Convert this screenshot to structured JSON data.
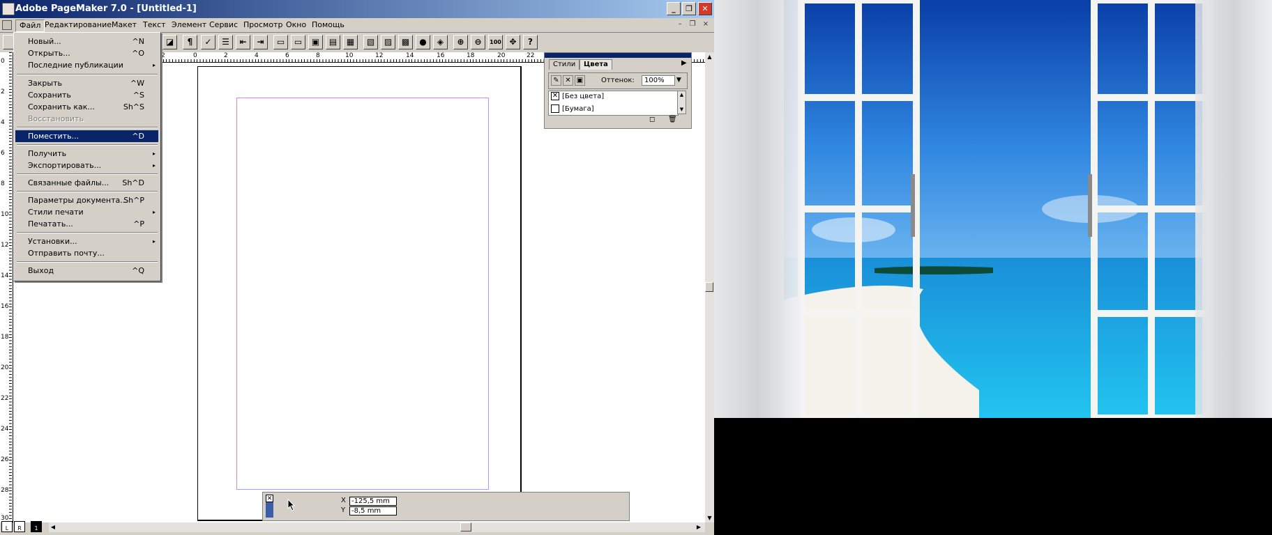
{
  "window": {
    "title": "Adobe PageMaker 7.0 - [Untitled-1]",
    "min_label": "_",
    "max_label": "❐",
    "close_label": "✕"
  },
  "menubar": {
    "items": [
      "Файл",
      "Редактирование",
      "Макет",
      "Текст",
      "Элемент",
      "Сервис",
      "Просмотр",
      "Окно",
      "Помощь"
    ],
    "active": "Файл",
    "mdi_controls": [
      "–",
      "❐",
      "×"
    ]
  },
  "toolbar": {
    "icons": [
      "tool-icon",
      "new-icon",
      "paragraph-icon",
      "spell-icon",
      "bullets-icon",
      "indent-left-icon",
      "indent-right-icon",
      "copy-style-icon",
      "paste-style-icon",
      "frame-icon",
      "image-frame-icon",
      "link-icon",
      "insert-image-icon",
      "export-image-icon",
      "color-icon",
      "globe-icon",
      "pdf-icon",
      "zoom-in-icon",
      "zoom-out-icon",
      "actual-size-icon",
      "fit-icon",
      "help-icon"
    ],
    "glyphs": [
      "◪",
      "¶",
      "✓",
      "☰",
      "⇤",
      "⇥",
      "▭",
      "▭",
      "▣",
      "▤",
      "▦",
      "▧",
      "▨",
      "▩",
      "●",
      "◈",
      "⊕",
      "⊖",
      "100",
      "✥",
      "?"
    ]
  },
  "file_menu": {
    "items": [
      {
        "label": "Новый...",
        "shortcut": "^N"
      },
      {
        "label": "Открыть...",
        "shortcut": "^O"
      },
      {
        "label": "Последние публикации",
        "shortcut": "",
        "submenu": "▸"
      },
      {
        "sep": true
      },
      {
        "label": "Закрыть",
        "shortcut": "^W"
      },
      {
        "label": "Сохранить",
        "shortcut": "^S"
      },
      {
        "label": "Сохранить как...",
        "shortcut": "Sh^S"
      },
      {
        "label": "Восстановить",
        "shortcut": "",
        "disabled": true
      },
      {
        "sep": true
      },
      {
        "label": "Поместить...",
        "shortcut": "^D",
        "highlighted": true
      },
      {
        "sep": true
      },
      {
        "label": "Получить",
        "shortcut": "",
        "submenu": "▸"
      },
      {
        "label": "Экспортировать...",
        "shortcut": "",
        "submenu": "▸"
      },
      {
        "sep": true
      },
      {
        "label": "Связанные файлы...",
        "shortcut": "Sh^D"
      },
      {
        "sep": true
      },
      {
        "label": "Параметры документа...",
        "shortcut": "Sh^P"
      },
      {
        "label": "Стили печати",
        "shortcut": "",
        "submenu": "▸"
      },
      {
        "label": "Печатать...",
        "shortcut": "^P"
      },
      {
        "sep": true
      },
      {
        "label": "Установки...",
        "shortcut": "",
        "submenu": "▸"
      },
      {
        "label": "Отправить почту...",
        "shortcut": ""
      },
      {
        "sep": true
      },
      {
        "label": "Выход",
        "shortcut": "^Q"
      }
    ]
  },
  "hruler": {
    "labels": [
      "2",
      "0",
      "2",
      "4",
      "6",
      "8",
      "10",
      "12",
      "14",
      "16",
      "18",
      "20",
      "22"
    ]
  },
  "vruler": {
    "labels": [
      "0",
      "2",
      "4",
      "6",
      "8",
      "10",
      "12",
      "14",
      "16",
      "18",
      "20",
      "22",
      "24",
      "26",
      "28",
      "30"
    ]
  },
  "colors_palette": {
    "tab_styles": "Стили",
    "tab_colors": "Цвета",
    "tint_label": "Оттенок:",
    "tint_value": "100%",
    "list": [
      {
        "name": "[Без цвета]",
        "swatch": "✕"
      },
      {
        "name": "[Бумага]",
        "swatch": ""
      }
    ]
  },
  "control_palette": {
    "x_label": "X",
    "y_label": "Y",
    "x_value": "-125,5 mm",
    "y_value": "-8,5 mm"
  },
  "pages": {
    "left": "L",
    "right": "R",
    "current": "1"
  },
  "colors": {
    "title_bar": "#0a246a",
    "selection": "#0a246a",
    "margin_guide": "#e080e0",
    "face": "#d4d0c8"
  }
}
